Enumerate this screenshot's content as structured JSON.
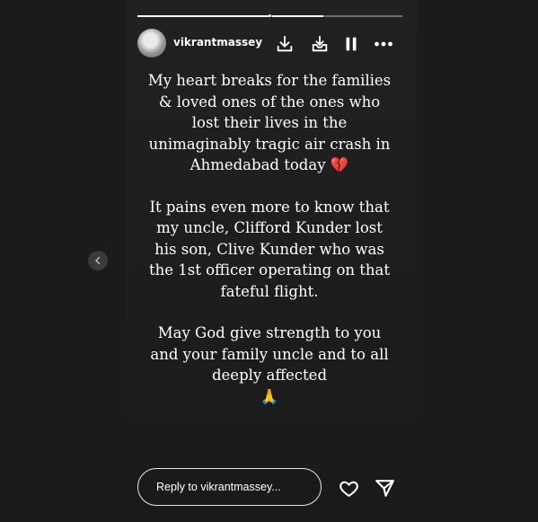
{
  "story": {
    "username": "vikrantmassey",
    "caption": {
      "p1": "My heart breaks for the families & loved ones of the ones who lost their lives in the unimaginably tragic air crash in Ahmedabad today",
      "p1_emoji": "💔",
      "p2": "It pains even more to know that my uncle, Clifford Kunder lost his son, Clive Kunder who was the 1st officer operating on that fateful flight.",
      "p3": "May God give strength to you and your family uncle and to all deeply affected",
      "p3_emoji": "🙏"
    }
  },
  "progress": {
    "segment_count": 2,
    "current_segment_fraction": 0.7
  },
  "reply": {
    "placeholder": "Reply to vikrantmassey..."
  },
  "icons": {
    "download": "download-icon",
    "download_alt": "download-inbox-icon",
    "pause": "pause-icon",
    "more": "more-icon",
    "prev": "chevron-left-icon",
    "like": "heart-icon",
    "share": "send-icon"
  }
}
